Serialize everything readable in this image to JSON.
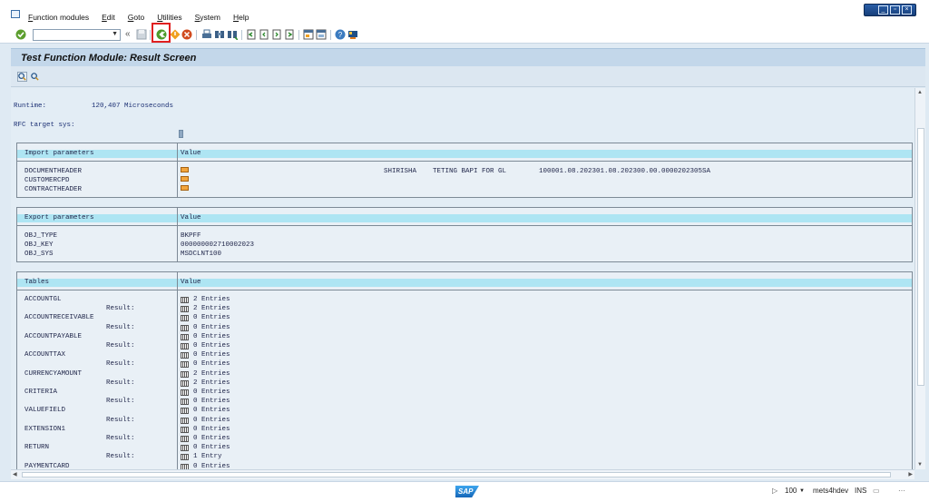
{
  "menu": {
    "items": [
      "Function modules",
      "Edit",
      "Goto",
      "Utilities",
      "System",
      "Help"
    ]
  },
  "toolbar": {
    "command_field_value": "",
    "icons": [
      "enter-icon",
      "back-icon",
      "exit-icon",
      "cancel-icon",
      "print-icon",
      "find-icon",
      "find-next-icon",
      "first-page-icon",
      "previous-page-icon",
      "next-page-icon",
      "last-page-icon",
      "new-session-icon",
      "shortcut-icon",
      "help-icon",
      "customize-layout-icon"
    ]
  },
  "title": "Test Function Module: Result Screen",
  "runtime": {
    "label": "Runtime:",
    "value": "120,407 Microseconds"
  },
  "rfc": {
    "label": "RFC target sys:"
  },
  "import_section": {
    "header_left": "Import parameters",
    "header_right": "Value",
    "rows": [
      {
        "name": "DOCUMENTHEADER",
        "value": "SHIRISHA    TETING BAPI FOR GL        100001.08.202301.08.202300.00.0000202305SA"
      },
      {
        "name": "CUSTOMERCPD",
        "value": ""
      },
      {
        "name": "CONTRACTHEADER",
        "value": ""
      }
    ]
  },
  "export_section": {
    "header_left": "Export parameters",
    "header_right": "Value",
    "rows": [
      {
        "name": "OBJ_TYPE",
        "value": "BKPFF"
      },
      {
        "name": "OBJ_KEY",
        "value": "000000002710002023"
      },
      {
        "name": "OBJ_SYS",
        "value": "MSDCLNT100"
      }
    ]
  },
  "tables_section": {
    "header_left": "Tables",
    "header_right": "Value",
    "result_label": "Result:",
    "rows": [
      {
        "name": "ACCOUNTGL",
        "value": "2 Entries",
        "result": "2 Entries"
      },
      {
        "name": "ACCOUNTRECEIVABLE",
        "value": "0 Entries",
        "result": "0 Entries"
      },
      {
        "name": "ACCOUNTPAYABLE",
        "value": "0 Entries",
        "result": "0 Entries"
      },
      {
        "name": "ACCOUNTTAX",
        "value": "0 Entries",
        "result": "0 Entries"
      },
      {
        "name": "CURRENCYAMOUNT",
        "value": "2 Entries",
        "result": "2 Entries"
      },
      {
        "name": "CRITERIA",
        "value": "0 Entries",
        "result": "0 Entries"
      },
      {
        "name": "VALUEFIELD",
        "value": "0 Entries",
        "result": "0 Entries"
      },
      {
        "name": "EXTENSION1",
        "value": "0 Entries",
        "result": "0 Entries"
      },
      {
        "name": "RETURN",
        "value": "0 Entries",
        "result": "1 Entry"
      },
      {
        "name": "PAYMENTCARD",
        "value": "0 Entries"
      }
    ]
  },
  "status": {
    "zoom": "100",
    "system": "mets4hdev",
    "mode": "INS"
  }
}
